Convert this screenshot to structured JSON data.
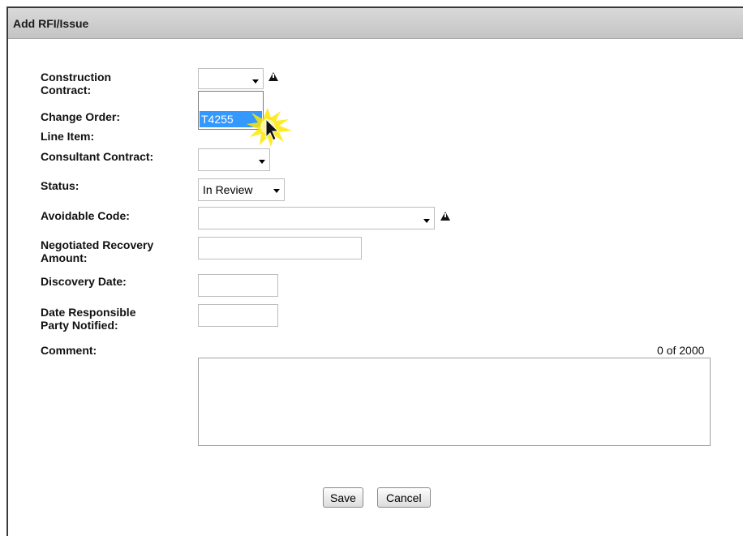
{
  "dialog": {
    "title": "Add RFI/Issue"
  },
  "form": {
    "construction_contract": {
      "label_line1": "Construction",
      "label_line2": "Contract:",
      "value": "",
      "options": [
        "",
        "T4255"
      ],
      "highlighted_option": "T4255"
    },
    "change_order": {
      "label": "Change Order:"
    },
    "line_item": {
      "label": "Line Item:"
    },
    "consultant_contract": {
      "label": "Consultant Contract:",
      "value": ""
    },
    "status": {
      "label": "Status:",
      "value": "In Review"
    },
    "avoidable_code": {
      "label": "Avoidable Code:",
      "value": ""
    },
    "negotiated_recovery_amount": {
      "label_line1": "Negotiated Recovery",
      "label_line2": "Amount:",
      "value": ""
    },
    "discovery_date": {
      "label": "Discovery Date:",
      "value": ""
    },
    "date_responsible_party_notified": {
      "label_line1": "Date Responsible",
      "label_line2": "Party Notified:",
      "value": ""
    },
    "comment": {
      "label": "Comment:",
      "value": "",
      "counter": "0 of 2000"
    }
  },
  "buttons": {
    "save_label": "Save",
    "cancel_label": "Cancel"
  },
  "icons": {
    "required_marker": "warning-triangle-icon",
    "dropdown_arrow": "chevron-down-icon",
    "mouse_cursor": "mouse-pointer-icon"
  },
  "colors": {
    "selection_highlight": "#3399ff",
    "titlebar": "#cfcfcf",
    "click_burst": "#ffe600"
  }
}
